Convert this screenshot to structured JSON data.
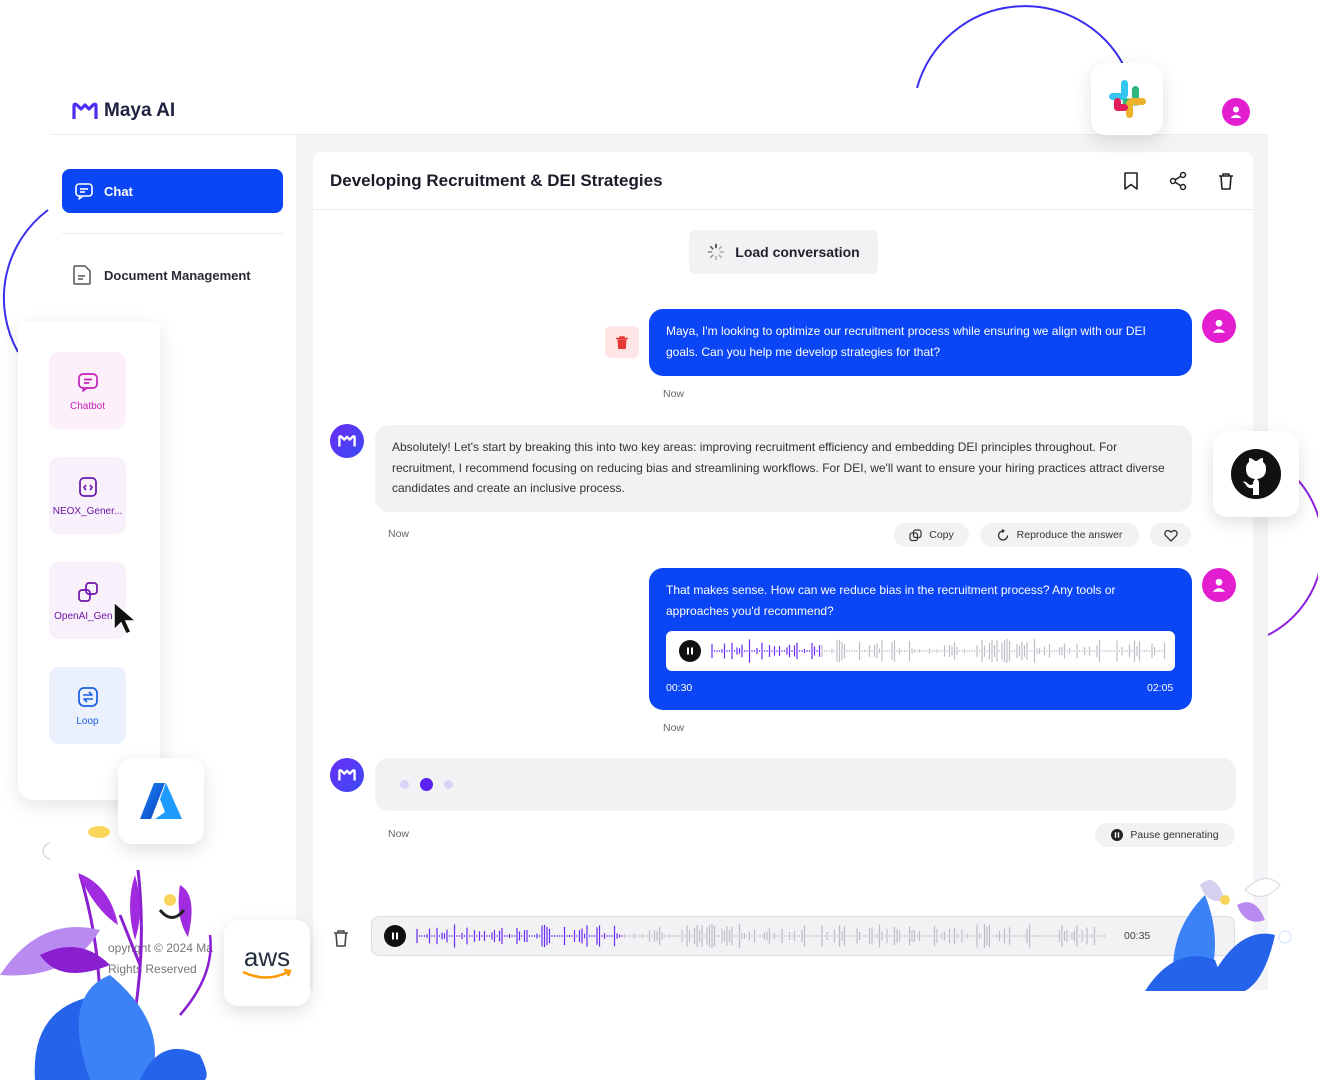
{
  "app": {
    "brand": "Maya AI"
  },
  "sidebar": {
    "chat_label": "Chat",
    "doc_label": "Document Management",
    "footer": [
      "opyright © 2024 Ma",
      "Rights Reserved"
    ]
  },
  "tools": [
    {
      "label": "Chatbot"
    },
    {
      "label": "NEOX_Gener..."
    },
    {
      "label": "OpenAI_Gen..."
    },
    {
      "label": "Loop"
    }
  ],
  "conversation": {
    "title": "Developing Recruitment & DEI Strategies",
    "load_label": "Load conversation",
    "messages": [
      {
        "role": "user",
        "text": "Maya, I'm looking to optimize our recruitment process while ensuring we align with our DEI goals. Can you help me develop strategies for that?",
        "time": "Now"
      },
      {
        "role": "assistant",
        "text": "Absolutely! Let's start by breaking this into two key areas: improving recruitment efficiency and embedding DEI principles throughout. For recruitment, I recommend focusing on reducing bias and streamlining workflows. For DEI, we'll want to ensure your hiring practices attract diverse candidates and create an inclusive process.",
        "time": "Now"
      },
      {
        "role": "user",
        "text": "That makes sense. How can we reduce bias in the recruitment process? Any tools or approaches you'd recommend?",
        "time": "Now",
        "audio": {
          "current": "00:30",
          "total": "02:05",
          "progress": 0.24
        }
      },
      {
        "role": "assistant",
        "status": "generating",
        "time": "Now"
      }
    ],
    "actions": {
      "copy": "Copy",
      "reproduce": "Reproduce the answer",
      "pause": "Pause gennerating"
    },
    "recorder": {
      "time": "00:35",
      "progress": 0.3
    }
  },
  "integrations": [
    "slack",
    "github",
    "azure",
    "aws"
  ],
  "aws_label": "aws",
  "colors": {
    "primary": "#0a46f5",
    "accent": "#e21ed0",
    "purple": "#6a2cf5"
  }
}
